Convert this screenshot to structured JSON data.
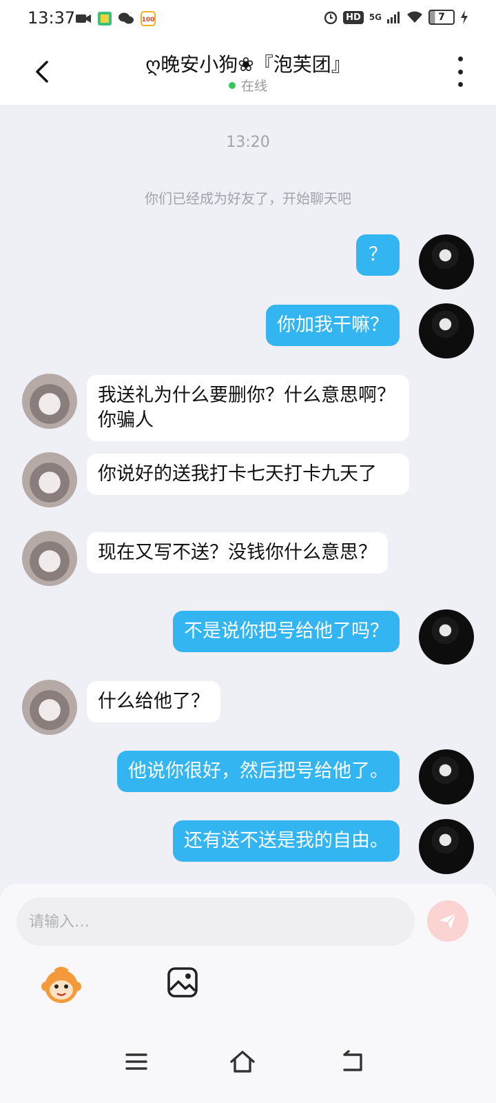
{
  "status_bar": {
    "time": "13:37",
    "icons_left": [
      "video-icon",
      "app-icon",
      "wechat-icon",
      "app-100-icon"
    ],
    "hd_label": "HD",
    "network_label": "5G",
    "battery_level": "7",
    "icons_right": [
      "alarm-icon",
      "signal-icon",
      "wifi-icon",
      "battery-icon",
      "charging-icon"
    ]
  },
  "header": {
    "title": "ღ晚安小狗❀『泡芙团』",
    "status": "在线",
    "status_color": "#34c759"
  },
  "chat": {
    "timestamp": "13:20",
    "system_message": "你们已经成为好友了，开始聊天吧",
    "messages": [
      {
        "side": "out",
        "text": "？"
      },
      {
        "side": "out",
        "text": "你加我干嘛？"
      },
      {
        "side": "in",
        "text": "我送礼为什么要删你？什么意思啊？你骗人"
      },
      {
        "side": "in",
        "text": "你说好的送我打卡七天打卡九天了"
      },
      {
        "side": "in",
        "text": "现在又写不送？没钱你什么意思？"
      },
      {
        "side": "out",
        "text": "不是说你把号给他了吗？"
      },
      {
        "side": "in",
        "text": "什么给他了？"
      },
      {
        "side": "out",
        "text": "他说你很好，然后把号给他了。"
      },
      {
        "side": "out",
        "text": "还有送不送是我的自由。"
      }
    ],
    "outgoing_color": "#33b5f1",
    "incoming_color": "#ffffff"
  },
  "composer": {
    "placeholder": "请输入…",
    "value": "",
    "send_icon": "send-icon",
    "tools": [
      "emoji-monkey-icon",
      "image-icon"
    ]
  },
  "nav_bar": {
    "icons": [
      "menu-icon",
      "home-icon",
      "back-icon"
    ]
  }
}
